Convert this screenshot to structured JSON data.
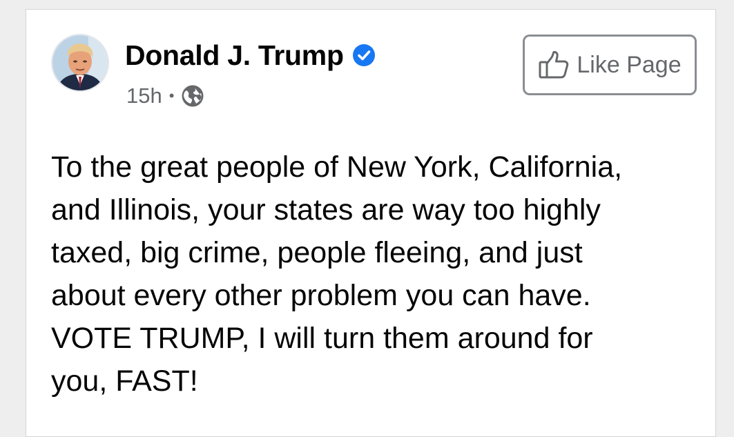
{
  "post": {
    "author": {
      "name": "Donald J. Trump",
      "verified_icon": "verified-badge-icon",
      "avatar_icon": "profile-photo"
    },
    "meta": {
      "timestamp": "15h",
      "separator": "•",
      "audience_icon": "globe-icon"
    },
    "like_page_button": {
      "label": "Like Page",
      "icon": "thumbs-up-icon"
    },
    "body_text": "To the great people of New York, California,\nand Illinois, your states are way too highly\ntaxed, big crime, people fleeing, and just\nabout every other problem you can have.\nVOTE TRUMP, I will turn them around for\nyou, FAST!"
  },
  "colors": {
    "verified_blue": "#1877f2",
    "secondary_text": "#65676b",
    "primary_text": "#050505",
    "button_border": "#8a8d91"
  }
}
